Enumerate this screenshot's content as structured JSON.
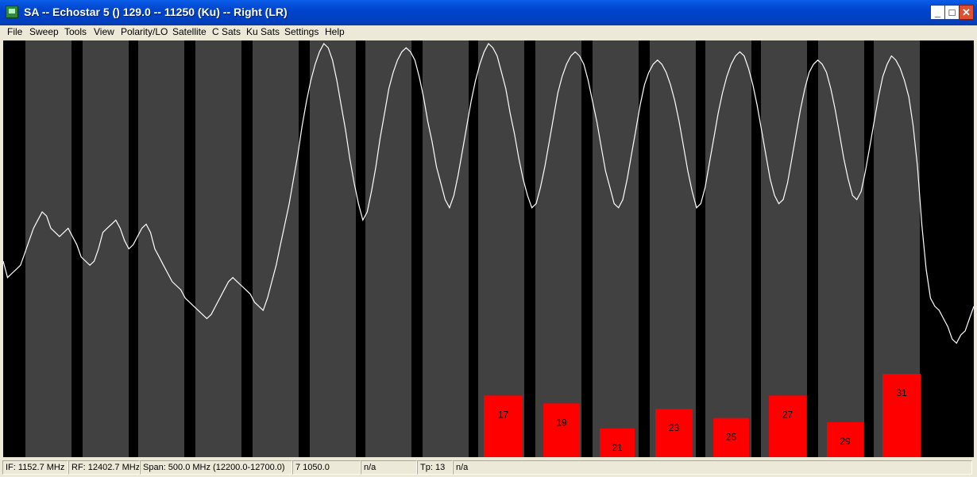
{
  "window": {
    "title": "SA -- Echostar 5 () 129.0 -- 11250 (Ku) -- Right (LR)",
    "minimize": "_",
    "maximize": "□",
    "close": "✕"
  },
  "menu": {
    "items": [
      "File",
      "Sweep",
      "Tools",
      "View",
      "Polarity/LO",
      "Satellite",
      "C Sats",
      "Ku Sats",
      "Settings",
      "Help"
    ]
  },
  "chart_data": {
    "type": "line",
    "title": "",
    "xlabel": "",
    "ylabel": "",
    "grid": false,
    "colors": {
      "background": "#000000",
      "channel_band": "#414141",
      "trace": "#ffffff",
      "signal_bar": "#ff0000",
      "bar_label": "#000000"
    },
    "bars": [
      {
        "label": "17",
        "value": 0.148
      },
      {
        "label": "19",
        "value": 0.129
      },
      {
        "label": "21",
        "value": 0.069
      },
      {
        "label": "23",
        "value": 0.116
      },
      {
        "label": "25",
        "value": 0.094
      },
      {
        "label": "27",
        "value": 0.148
      },
      {
        "label": "29",
        "value": 0.084
      },
      {
        "label": "31",
        "value": 0.2
      }
    ],
    "series": [
      {
        "values": [
          0.47,
          0.43,
          0.44,
          0.45,
          0.46,
          0.49,
          0.52,
          0.55,
          0.57,
          0.59,
          0.58,
          0.55,
          0.54,
          0.53,
          0.54,
          0.55,
          0.53,
          0.51,
          0.48,
          0.47,
          0.46,
          0.47,
          0.5,
          0.54,
          0.55,
          0.56,
          0.57,
          0.55,
          0.52,
          0.5,
          0.51,
          0.53,
          0.55,
          0.56,
          0.54,
          0.5,
          0.48,
          0.46,
          0.44,
          0.42,
          0.41,
          0.4,
          0.38,
          0.37,
          0.36,
          0.35,
          0.34,
          0.33,
          0.34,
          0.36,
          0.38,
          0.4,
          0.42,
          0.43,
          0.42,
          0.41,
          0.4,
          0.39,
          0.37,
          0.36,
          0.35,
          0.38,
          0.42,
          0.46,
          0.51,
          0.56,
          0.61,
          0.67,
          0.73,
          0.8,
          0.86,
          0.91,
          0.95,
          0.98,
          1.0,
          0.99,
          0.96,
          0.91,
          0.85,
          0.79,
          0.72,
          0.66,
          0.61,
          0.57,
          0.59,
          0.64,
          0.7,
          0.77,
          0.83,
          0.89,
          0.93,
          0.96,
          0.98,
          0.99,
          0.98,
          0.96,
          0.92,
          0.87,
          0.81,
          0.76,
          0.7,
          0.66,
          0.62,
          0.6,
          0.63,
          0.68,
          0.74,
          0.8,
          0.86,
          0.91,
          0.95,
          0.98,
          1.0,
          0.99,
          0.97,
          0.93,
          0.89,
          0.83,
          0.78,
          0.72,
          0.67,
          0.63,
          0.6,
          0.61,
          0.65,
          0.7,
          0.76,
          0.82,
          0.88,
          0.92,
          0.95,
          0.97,
          0.98,
          0.97,
          0.95,
          0.91,
          0.86,
          0.81,
          0.75,
          0.69,
          0.65,
          0.61,
          0.6,
          0.62,
          0.67,
          0.73,
          0.79,
          0.85,
          0.9,
          0.93,
          0.95,
          0.96,
          0.95,
          0.93,
          0.9,
          0.86,
          0.81,
          0.75,
          0.69,
          0.64,
          0.6,
          0.61,
          0.65,
          0.71,
          0.77,
          0.83,
          0.88,
          0.92,
          0.95,
          0.97,
          0.98,
          0.97,
          0.94,
          0.9,
          0.85,
          0.79,
          0.73,
          0.67,
          0.63,
          0.61,
          0.62,
          0.66,
          0.72,
          0.78,
          0.84,
          0.89,
          0.93,
          0.95,
          0.96,
          0.95,
          0.93,
          0.89,
          0.84,
          0.78,
          0.72,
          0.67,
          0.63,
          0.62,
          0.64,
          0.69,
          0.75,
          0.81,
          0.87,
          0.92,
          0.95,
          0.97,
          0.96,
          0.94,
          0.91,
          0.87,
          0.8,
          0.7,
          0.56,
          0.45,
          0.38,
          0.36,
          0.35,
          0.33,
          0.31,
          0.28,
          0.27,
          0.29,
          0.3,
          0.33,
          0.36
        ]
      }
    ]
  },
  "status": {
    "if": "IF: 1152.7 MHz",
    "rf": "RF: 12402.7 MHz",
    "span": "Span: 500.0 MHz (12200.0-12700.0)",
    "cell4": "7 1050.0",
    "cell5": "n/a",
    "tp": "Tp: 13",
    "cell7": "n/a"
  }
}
